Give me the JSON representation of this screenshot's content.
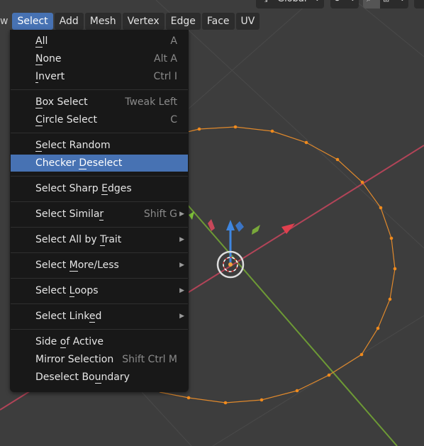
{
  "header": {
    "transform_orientation": "Global",
    "pivot_icon": "pivot-icon",
    "snap_icon": "snap-icon"
  },
  "menubar": {
    "items": [
      {
        "label": "w",
        "cut": true
      },
      {
        "label": "Select",
        "active": true
      },
      {
        "label": "Add"
      },
      {
        "label": "Mesh"
      },
      {
        "label": "Vertex"
      },
      {
        "label": "Edge"
      },
      {
        "label": "Face"
      },
      {
        "label": "UV"
      }
    ]
  },
  "select_menu": {
    "groups": [
      [
        {
          "label": "All",
          "ul": "A",
          "shortcut": "A"
        },
        {
          "label": "None",
          "ul": "N",
          "shortcut": "Alt A"
        },
        {
          "label": "Invert",
          "ul": "I",
          "shortcut": "Ctrl I"
        }
      ],
      [
        {
          "label": "Box Select",
          "ul": "B",
          "shortcut": "Tweak Left"
        },
        {
          "label": "Circle Select",
          "ul": "C",
          "shortcut": "C"
        }
      ],
      [
        {
          "label": "Select Random",
          "ul": "S",
          "shortcut": ""
        },
        {
          "label": "Checker Deselect",
          "ul": "D",
          "shortcut": "",
          "highlighted": true
        }
      ],
      [
        {
          "label": "Select Sharp Edges",
          "ul": "E",
          "shortcut": ""
        }
      ],
      [
        {
          "label": "Select Similar",
          "ul": "r",
          "shortcut": "Shift G",
          "submenu": true
        }
      ],
      [
        {
          "label": "Select All by Trait",
          "ul": "T",
          "shortcut": "",
          "submenu": true
        }
      ],
      [
        {
          "label": "Select More/Less",
          "ul": "M",
          "shortcut": "",
          "submenu": true
        }
      ],
      [
        {
          "label": "Select Loops",
          "ul": "L",
          "shortcut": "",
          "submenu": true
        }
      ],
      [
        {
          "label": "Select Linked",
          "ul": "k",
          "shortcut": "",
          "submenu": true
        }
      ],
      [
        {
          "label": "Side of Active",
          "ul": "o",
          "shortcut": ""
        },
        {
          "label": "Mirror Selection",
          "ul": "",
          "shortcut": "Shift Ctrl M"
        },
        {
          "label": "Deselect Boundary",
          "ul": "u",
          "shortcut": ""
        }
      ]
    ]
  },
  "colors": {
    "accent": "#4772b3",
    "menu_bg": "#181818",
    "viewport_bg": "#3d3d3d",
    "x_axis": "#c8485a",
    "y_axis": "#79a83a",
    "z_axis": "#3f86e0",
    "selection": "#f08a1c"
  }
}
